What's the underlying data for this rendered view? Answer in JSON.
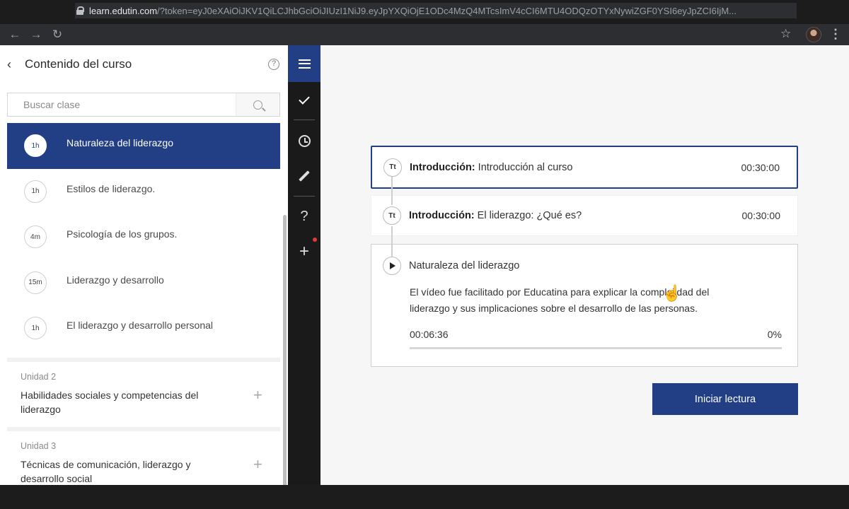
{
  "browser": {
    "url_host": "learn.edutin.com",
    "url_path": "/?token=eyJ0eXAiOiJKV1QiLCJhbGciOiJIUzI1NiJ9.eyJpYXQiOjE1ODc4MzQ4MTcsImV4cCI6MTU4ODQzOTYxNywiZGF0YSI6eyJpZCI6IjM...",
    "back_icon": "arrow-left-icon",
    "forward_icon": "arrow-right-icon",
    "reload_icon": "reload-icon"
  },
  "sidebar": {
    "title": "Contenido del curso",
    "search_placeholder": "Buscar clase",
    "lessons": [
      {
        "badge": "1h",
        "label": "Naturaleza del liderazgo",
        "active": true
      },
      {
        "badge": "1h",
        "label": "Estilos de liderazgo."
      },
      {
        "badge": "4m",
        "label": "Psicología de los grupos."
      },
      {
        "badge": "15m",
        "label": "Liderazgo y desarrollo"
      },
      {
        "badge": "1h",
        "label": "El liderazgo y desarrollo personal"
      }
    ],
    "units": [
      {
        "caption": "Unidad 2",
        "title": "Habilidades sociales y competencias del liderazgo"
      },
      {
        "caption": "Unidad 3",
        "title": "Técnicas de comunicación, liderazgo y desarrollo social"
      }
    ]
  },
  "rail": {
    "help_glyph": "?",
    "add_glyph": "+"
  },
  "main": {
    "cards": [
      {
        "icon": "Tt",
        "prefix": "Introducción:",
        "text": "Introducción al curso",
        "time": "00:30:00"
      },
      {
        "icon": "Tt",
        "prefix": "Introducción:",
        "text": "El liderazgo: ¿Qué es?",
        "time": "00:30:00"
      }
    ],
    "video": {
      "title": "Naturaleza del liderazgo",
      "description": "El vídeo fue facilitado por Educatina para explicar la complejidad del liderazgo y sus implicaciones sobre el desarrollo de las personas.",
      "elapsed": "00:06:36",
      "percent_label": "0%",
      "progress": 0
    },
    "start_button": "Iniciar lectura"
  },
  "colors": {
    "accent": "#223f86",
    "rail_bg": "#1a1a1a"
  }
}
